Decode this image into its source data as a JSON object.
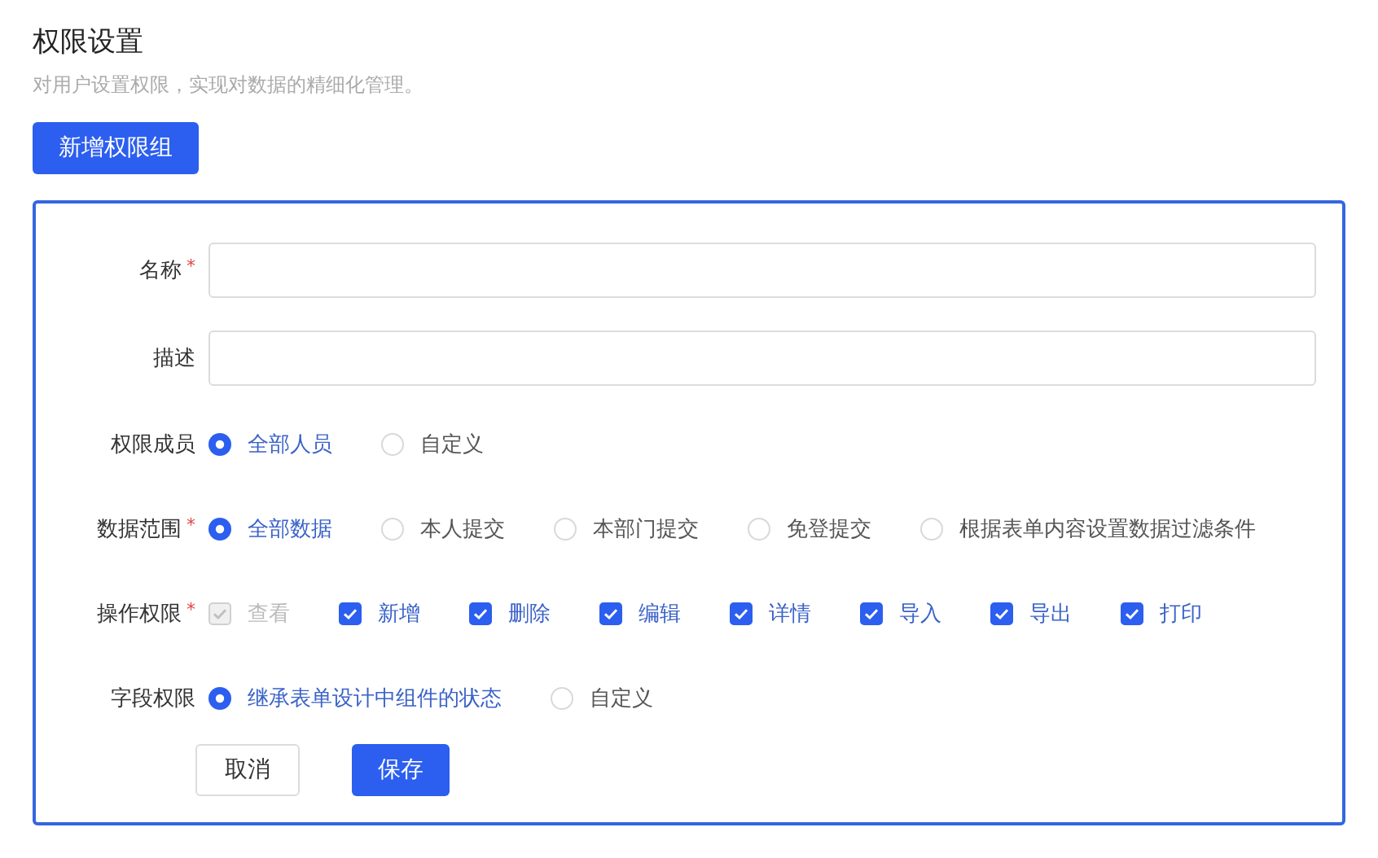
{
  "header": {
    "title": "权限设置",
    "subtitle": "对用户设置权限，实现对数据的精细化管理。"
  },
  "add_button": "新增权限组",
  "form": {
    "rows": [
      {
        "kind": "text",
        "label": "名称",
        "required_mark": "*",
        "value": ""
      },
      {
        "kind": "text",
        "label": "描述",
        "value": ""
      },
      {
        "kind": "radio",
        "label": "权限成员",
        "options": [
          {
            "label": "全部人员",
            "selected": true
          },
          {
            "label": "自定义",
            "selected": false
          }
        ]
      },
      {
        "kind": "radio",
        "label": "数据范围",
        "required_mark": "*",
        "options": [
          {
            "label": "全部数据",
            "selected": true
          },
          {
            "label": "本人提交",
            "selected": false
          },
          {
            "label": "本部门提交",
            "selected": false
          },
          {
            "label": "免登提交",
            "selected": false
          },
          {
            "label": "根据表单内容设置数据过滤条件",
            "selected": false
          }
        ]
      },
      {
        "kind": "checkbox",
        "label": "操作权限",
        "required_mark": "*",
        "options": [
          {
            "label": "查看",
            "checked": true,
            "disabled": true
          },
          {
            "label": "新增",
            "checked": true,
            "disabled": false
          },
          {
            "label": "删除",
            "checked": true,
            "disabled": false
          },
          {
            "label": "编辑",
            "checked": true,
            "disabled": false
          },
          {
            "label": "详情",
            "checked": true,
            "disabled": false
          },
          {
            "label": "导入",
            "checked": true,
            "disabled": false
          },
          {
            "label": "导出",
            "checked": true,
            "disabled": false
          },
          {
            "label": "打印",
            "checked": true,
            "disabled": false
          }
        ]
      },
      {
        "kind": "radio",
        "label": "字段权限",
        "options": [
          {
            "label": "继承表单设计中组件的状态",
            "selected": true
          },
          {
            "label": "自定义",
            "selected": false
          }
        ]
      }
    ],
    "cancel_button": "取消",
    "save_button": "保存"
  }
}
